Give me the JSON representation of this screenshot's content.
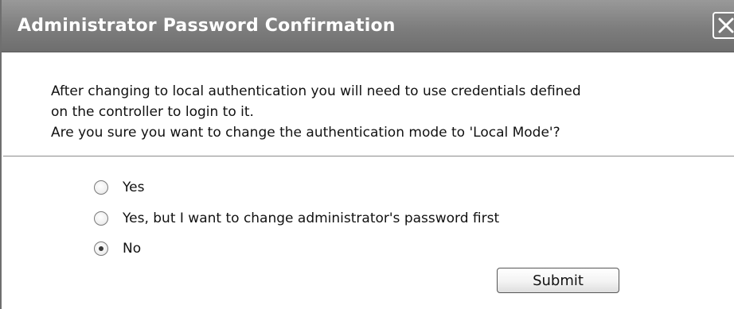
{
  "dialog": {
    "title": "Administrator Password Confirmation",
    "close_icon": "close-icon",
    "message_lines": [
      "After changing to local authentication you will need to use credentials defined",
      "on the controller to login to it.",
      "Are you sure you want to change the authentication mode to 'Local Mode'?"
    ],
    "options": [
      {
        "label": "Yes",
        "selected": false
      },
      {
        "label": "Yes, but I want to change administrator's password first",
        "selected": false
      },
      {
        "label": "No",
        "selected": true
      }
    ],
    "submit_label": "Submit"
  },
  "colors": {
    "titlebar": "#7d7d7d",
    "title_text": "#ffffff",
    "divider": "#8c8c8c"
  }
}
